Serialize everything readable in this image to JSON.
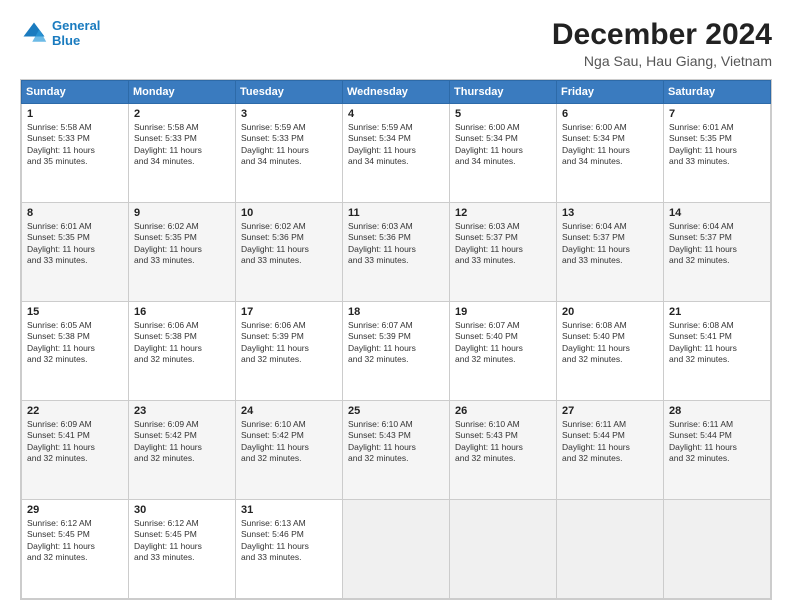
{
  "header": {
    "logo_line1": "General",
    "logo_line2": "Blue",
    "title": "December 2024",
    "subtitle": "Nga Sau, Hau Giang, Vietnam"
  },
  "calendar": {
    "days_of_week": [
      "Sunday",
      "Monday",
      "Tuesday",
      "Wednesday",
      "Thursday",
      "Friday",
      "Saturday"
    ],
    "weeks": [
      [
        {
          "day": "",
          "info": ""
        },
        {
          "day": "2",
          "info": "Sunrise: 5:58 AM\nSunset: 5:33 PM\nDaylight: 11 hours\nand 34 minutes."
        },
        {
          "day": "3",
          "info": "Sunrise: 5:59 AM\nSunset: 5:33 PM\nDaylight: 11 hours\nand 34 minutes."
        },
        {
          "day": "4",
          "info": "Sunrise: 5:59 AM\nSunset: 5:34 PM\nDaylight: 11 hours\nand 34 minutes."
        },
        {
          "day": "5",
          "info": "Sunrise: 6:00 AM\nSunset: 5:34 PM\nDaylight: 11 hours\nand 34 minutes."
        },
        {
          "day": "6",
          "info": "Sunrise: 6:00 AM\nSunset: 5:34 PM\nDaylight: 11 hours\nand 34 minutes."
        },
        {
          "day": "7",
          "info": "Sunrise: 6:01 AM\nSunset: 5:35 PM\nDaylight: 11 hours\nand 33 minutes."
        }
      ],
      [
        {
          "day": "1",
          "info": "Sunrise: 5:58 AM\nSunset: 5:33 PM\nDaylight: 11 hours\nand 35 minutes."
        },
        {
          "day": "9",
          "info": "Sunrise: 6:02 AM\nSunset: 5:35 PM\nDaylight: 11 hours\nand 33 minutes."
        },
        {
          "day": "10",
          "info": "Sunrise: 6:02 AM\nSunset: 5:36 PM\nDaylight: 11 hours\nand 33 minutes."
        },
        {
          "day": "11",
          "info": "Sunrise: 6:03 AM\nSunset: 5:36 PM\nDaylight: 11 hours\nand 33 minutes."
        },
        {
          "day": "12",
          "info": "Sunrise: 6:03 AM\nSunset: 5:37 PM\nDaylight: 11 hours\nand 33 minutes."
        },
        {
          "day": "13",
          "info": "Sunrise: 6:04 AM\nSunset: 5:37 PM\nDaylight: 11 hours\nand 33 minutes."
        },
        {
          "day": "14",
          "info": "Sunrise: 6:04 AM\nSunset: 5:37 PM\nDaylight: 11 hours\nand 32 minutes."
        }
      ],
      [
        {
          "day": "8",
          "info": "Sunrise: 6:01 AM\nSunset: 5:35 PM\nDaylight: 11 hours\nand 33 minutes."
        },
        {
          "day": "16",
          "info": "Sunrise: 6:06 AM\nSunset: 5:38 PM\nDaylight: 11 hours\nand 32 minutes."
        },
        {
          "day": "17",
          "info": "Sunrise: 6:06 AM\nSunset: 5:39 PM\nDaylight: 11 hours\nand 32 minutes."
        },
        {
          "day": "18",
          "info": "Sunrise: 6:07 AM\nSunset: 5:39 PM\nDaylight: 11 hours\nand 32 minutes."
        },
        {
          "day": "19",
          "info": "Sunrise: 6:07 AM\nSunset: 5:40 PM\nDaylight: 11 hours\nand 32 minutes."
        },
        {
          "day": "20",
          "info": "Sunrise: 6:08 AM\nSunset: 5:40 PM\nDaylight: 11 hours\nand 32 minutes."
        },
        {
          "day": "21",
          "info": "Sunrise: 6:08 AM\nSunset: 5:41 PM\nDaylight: 11 hours\nand 32 minutes."
        }
      ],
      [
        {
          "day": "15",
          "info": "Sunrise: 6:05 AM\nSunset: 5:38 PM\nDaylight: 11 hours\nand 32 minutes."
        },
        {
          "day": "23",
          "info": "Sunrise: 6:09 AM\nSunset: 5:42 PM\nDaylight: 11 hours\nand 32 minutes."
        },
        {
          "day": "24",
          "info": "Sunrise: 6:10 AM\nSunset: 5:42 PM\nDaylight: 11 hours\nand 32 minutes."
        },
        {
          "day": "25",
          "info": "Sunrise: 6:10 AM\nSunset: 5:43 PM\nDaylight: 11 hours\nand 32 minutes."
        },
        {
          "day": "26",
          "info": "Sunrise: 6:10 AM\nSunset: 5:43 PM\nDaylight: 11 hours\nand 32 minutes."
        },
        {
          "day": "27",
          "info": "Sunrise: 6:11 AM\nSunset: 5:44 PM\nDaylight: 11 hours\nand 32 minutes."
        },
        {
          "day": "28",
          "info": "Sunrise: 6:11 AM\nSunset: 5:44 PM\nDaylight: 11 hours\nand 32 minutes."
        }
      ],
      [
        {
          "day": "22",
          "info": "Sunrise: 6:09 AM\nSunset: 5:41 PM\nDaylight: 11 hours\nand 32 minutes."
        },
        {
          "day": "30",
          "info": "Sunrise: 6:12 AM\nSunset: 5:45 PM\nDaylight: 11 hours\nand 33 minutes."
        },
        {
          "day": "31",
          "info": "Sunrise: 6:13 AM\nSunset: 5:46 PM\nDaylight: 11 hours\nand 33 minutes."
        },
        {
          "day": "",
          "info": ""
        },
        {
          "day": "",
          "info": ""
        },
        {
          "day": "",
          "info": ""
        },
        {
          "day": "",
          "info": ""
        }
      ],
      [
        {
          "day": "29",
          "info": "Sunrise: 6:12 AM\nSunset: 5:45 PM\nDaylight: 11 hours\nand 32 minutes."
        },
        {
          "day": "",
          "info": ""
        },
        {
          "day": "",
          "info": ""
        },
        {
          "day": "",
          "info": ""
        },
        {
          "day": "",
          "info": ""
        },
        {
          "day": "",
          "info": ""
        },
        {
          "day": "",
          "info": ""
        }
      ]
    ]
  }
}
